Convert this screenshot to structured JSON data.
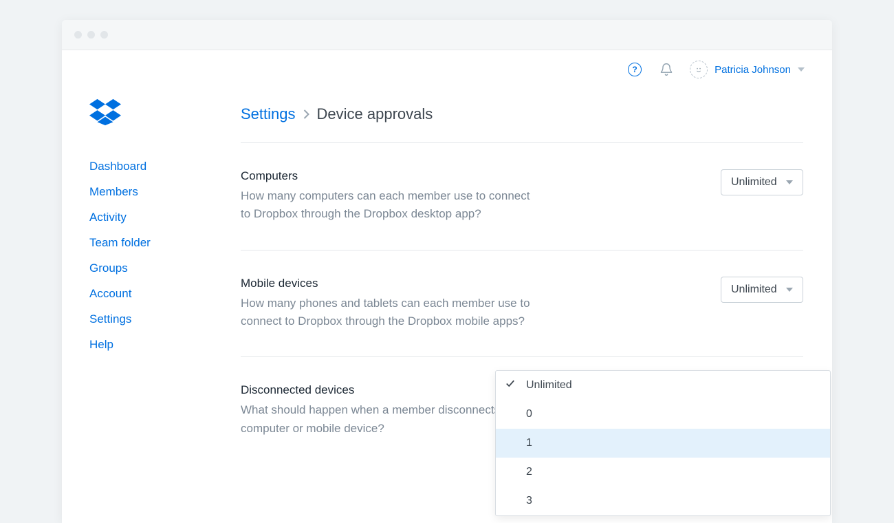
{
  "user": {
    "name": "Patricia Johnson"
  },
  "sidebar": {
    "items": [
      {
        "label": "Dashboard"
      },
      {
        "label": "Members"
      },
      {
        "label": "Activity"
      },
      {
        "label": "Team folder"
      },
      {
        "label": "Groups"
      },
      {
        "label": "Account"
      },
      {
        "label": "Settings"
      },
      {
        "label": "Help"
      }
    ]
  },
  "breadcrumb": {
    "parent": "Settings",
    "current": "Device approvals"
  },
  "settings": {
    "computers": {
      "title": "Computers",
      "desc": "How many computers can each member use to connect to Dropbox through the Dropbox desktop app?",
      "value": "Unlimited"
    },
    "mobile": {
      "title": "Mobile devices",
      "desc": "How many phones and tablets can each member use to connect to Dropbox through the Dropbox mobile apps?",
      "value": "Unlimited"
    },
    "disconnected": {
      "title": "Disconnected devices",
      "desc": "What should happen when a member disconnects a computer or mobile device?"
    }
  },
  "dropdown_menu": {
    "options": [
      {
        "label": "Unlimited",
        "selected": true,
        "highlighted": false
      },
      {
        "label": "0",
        "selected": false,
        "highlighted": false
      },
      {
        "label": "1",
        "selected": false,
        "highlighted": true
      },
      {
        "label": "2",
        "selected": false,
        "highlighted": false
      },
      {
        "label": "3",
        "selected": false,
        "highlighted": false
      }
    ]
  }
}
